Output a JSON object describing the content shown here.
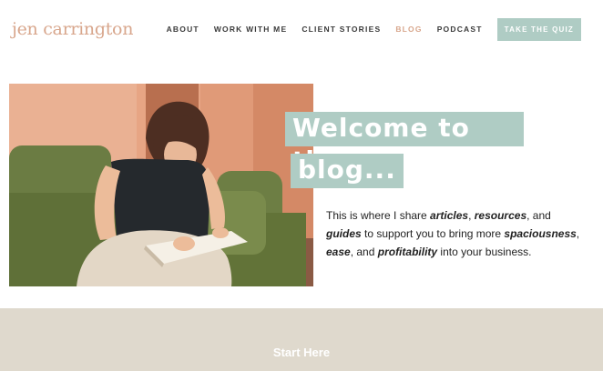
{
  "brand": {
    "logo_text": "jen carrington"
  },
  "nav": {
    "items": [
      {
        "label": "ABOUT"
      },
      {
        "label": "WORK WITH ME"
      },
      {
        "label": "CLIENT STORIES"
      },
      {
        "label": "BLOG"
      },
      {
        "label": "PODCAST"
      }
    ],
    "active_item": "BLOG",
    "cta_label": "TAKE THE QUIZ"
  },
  "hero": {
    "title_line1": "Welcome to the",
    "title_line2": "blog...",
    "intro": {
      "p1": "This is where I share ",
      "articles": "articles",
      "p2": ", ",
      "resources": "resources",
      "p3": ", and ",
      "guides": "guides",
      "p4": " to support you to bring more ",
      "spaciousness": "spaciousness",
      "p5": ", ",
      "ease": "ease",
      "p6": ", and ",
      "profitability": "profitability",
      "p7": " into your business."
    }
  },
  "footer_band": {
    "label": "Start Here"
  },
  "colors": {
    "accent_mint": "#afccc4",
    "accent_peach": "#d8a68c",
    "band_beige": "#dfd9cd"
  }
}
